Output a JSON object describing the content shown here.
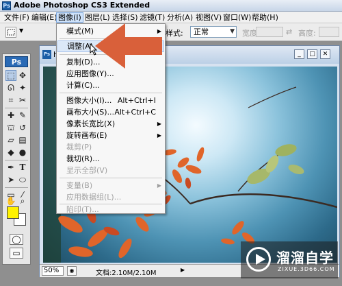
{
  "app": {
    "title": "Adobe Photoshop CS3 Extended",
    "badge": "Ps"
  },
  "menubar": {
    "items": [
      "文件(F)",
      "编辑(E)",
      "图像(I)",
      "图层(L)",
      "选择(S)",
      "滤镜(T)",
      "分析(A)",
      "视图(V)",
      "窗口(W)",
      "帮助(H)"
    ],
    "active": "图像(I)"
  },
  "options": {
    "style_label": "样式:",
    "style_value": "正常",
    "width_label": "宽度:",
    "height_label": "高度:"
  },
  "document": {
    "title": "hu",
    "zoom": "50%",
    "doc_info": "文档:2.10M/2.10M"
  },
  "image_menu": {
    "items": [
      {
        "label": "模式(M)",
        "shortcut": "",
        "submenu": true,
        "disabled": false
      },
      {
        "label": "调整(A)",
        "shortcut": "",
        "submenu": true,
        "disabled": false,
        "highlighted": true
      },
      {
        "label": "复制(D)...",
        "shortcut": "",
        "submenu": false,
        "disabled": false
      },
      {
        "label": "应用图像(Y)...",
        "shortcut": "",
        "submenu": false,
        "disabled": false
      },
      {
        "label": "计算(C)...",
        "shortcut": "",
        "submenu": false,
        "disabled": false
      },
      {
        "label": "图像大小(I)...",
        "shortcut": "Alt+Ctrl+I",
        "submenu": false,
        "disabled": false
      },
      {
        "label": "画布大小(S)...",
        "shortcut": "Alt+Ctrl+C",
        "submenu": false,
        "disabled": false
      },
      {
        "label": "像素长宽比(X)",
        "shortcut": "",
        "submenu": true,
        "disabled": false
      },
      {
        "label": "旋转画布(E)",
        "shortcut": "",
        "submenu": true,
        "disabled": false
      },
      {
        "label": "裁剪(P)",
        "shortcut": "",
        "submenu": false,
        "disabled": true
      },
      {
        "label": "裁切(R)...",
        "shortcut": "",
        "submenu": false,
        "disabled": false
      },
      {
        "label": "显示全部(V)",
        "shortcut": "",
        "submenu": false,
        "disabled": true
      },
      {
        "label": "变量(B)",
        "shortcut": "",
        "submenu": true,
        "disabled": true
      },
      {
        "label": "应用数据组(L)...",
        "shortcut": "",
        "submenu": false,
        "disabled": true
      },
      {
        "label": "陷印(T)...",
        "shortcut": "",
        "submenu": false,
        "disabled": true
      }
    ]
  },
  "toolbox": {
    "badge": "Ps",
    "foreground_color": "#fff200",
    "background_color": "#ffffff"
  },
  "annotation_arrow": {
    "color": "#d9603a"
  },
  "watermark": {
    "brand": "溜溜自学",
    "url": "ZIXUE.3D66.COM"
  }
}
